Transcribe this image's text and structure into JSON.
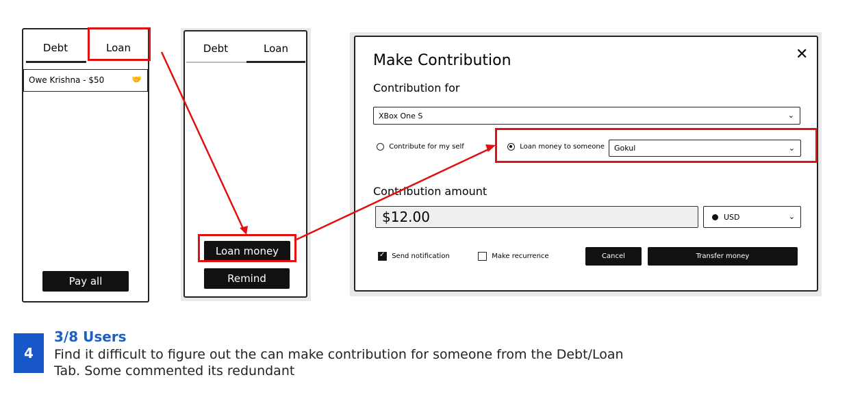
{
  "colors": {
    "highlight": "#e01010",
    "accent": "#1f5fbf",
    "badge": "#1757c7",
    "dark_button": "#111111"
  },
  "phone1": {
    "tabs": [
      "Debt",
      "Loan"
    ],
    "row": "Owe Krishna - $50",
    "row_icon": "handshake-icon",
    "pay_all": "Pay all"
  },
  "phone2": {
    "tabs": [
      "Debt",
      "Loan"
    ],
    "loan_money": "Loan money",
    "remind": "Remind"
  },
  "dialog": {
    "title": "Make Contribution",
    "contribution_for": "Contribution for",
    "item": "XBox One S",
    "contribute_self": "Contribute for my self",
    "loan_someone": "Loan money to someone",
    "person": "Gokul",
    "amount_label": "Contribution amount",
    "amount": "$12.00",
    "currency": "USD",
    "send_notification": "Send notification",
    "make_recurrence": "Make recurrence",
    "cancel": "Cancel",
    "transfer": "Transfer money"
  },
  "note": {
    "number": "4",
    "title": "3/8 Users",
    "line1": "Find it difficult to figure out the can make contribution for someone from the Debt/Loan",
    "line2": "Tab. Some commented its redundant"
  }
}
